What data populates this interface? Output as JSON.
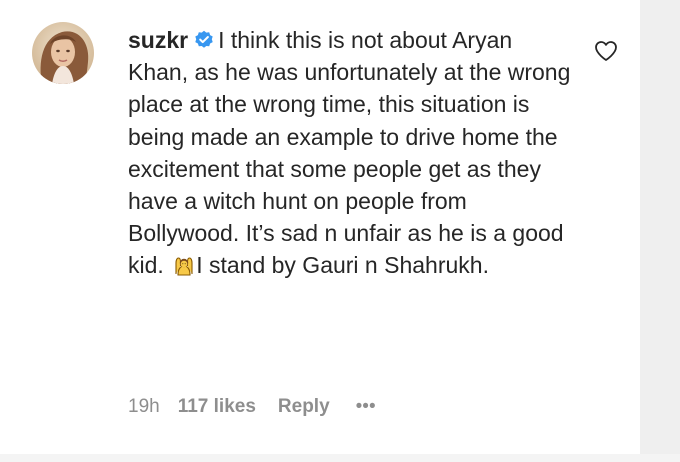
{
  "comment": {
    "username": "suzkr",
    "verified": true,
    "text_part1": "I think this is not about Aryan Khan, as he was unfortunately at the wrong place at the wrong time, this situation is being made an example to drive home the excitement that some people get as they have a witch hunt on people from Bollywood. It’s sad n unfair as he is a good kid.",
    "emoji_name": "person-raising-both-hands-icon",
    "text_part2": "I stand by Gauri n Shahrukh.",
    "timestamp": "19h",
    "likes": "117 likes",
    "reply_label": "Reply",
    "more_label": "•••"
  },
  "colors": {
    "text": "#262626",
    "secondary": "#8e8e8e",
    "verified_blue": "#3897f0",
    "side_gray": "#efefef"
  },
  "icons": {
    "verified": "verified-badge-icon",
    "like": "heart-outline-icon",
    "more": "more-options-icon"
  }
}
